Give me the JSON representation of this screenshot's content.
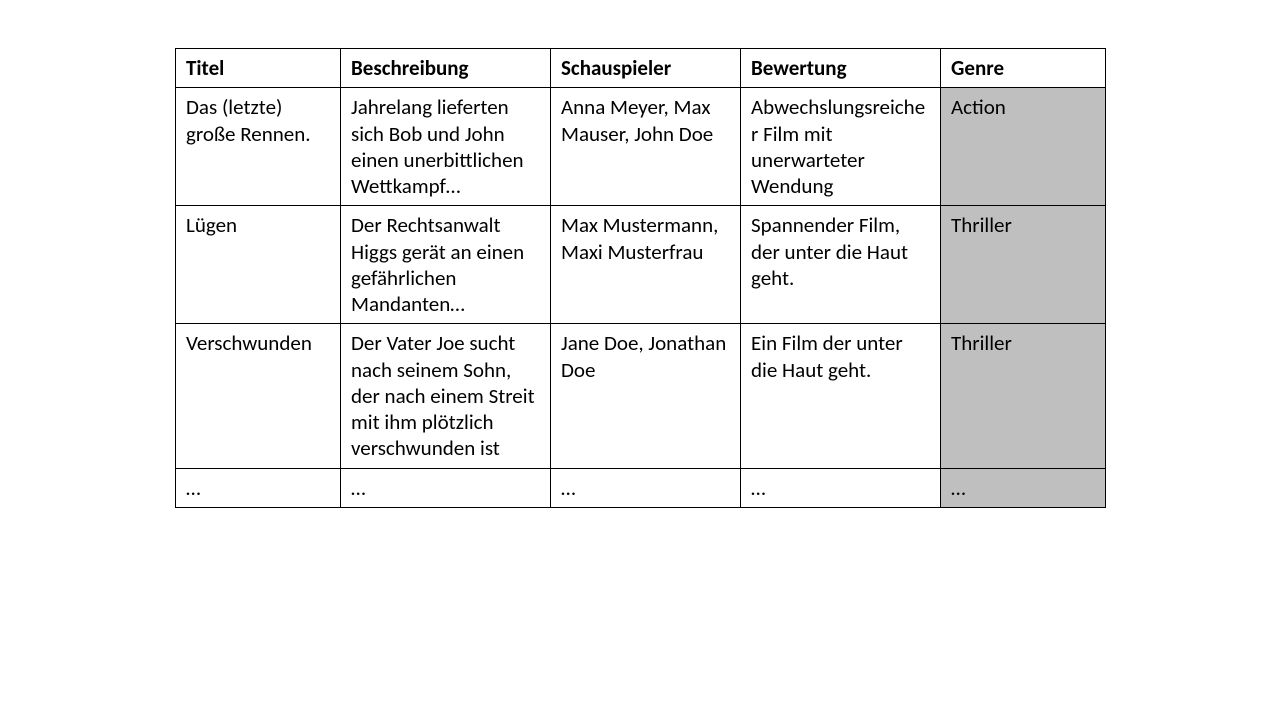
{
  "chart_data": {
    "type": "table",
    "columns": [
      "Titel",
      "Beschreibung",
      "Schauspieler",
      "Bewertung",
      "Genre"
    ],
    "rows": [
      [
        "Das (letzte) große Rennen.",
        "Jahrelang lieferten sich Bob und John einen unerbittlichen Wettkampf…",
        "Anna Meyer, Max Mauser, John Doe",
        "Abwechslungsreicher Film mit unerwarteter Wendung",
        "Action"
      ],
      [
        "Lügen",
        "Der Rechtsanwalt Higgs gerät an einen gefährlichen Mandanten…",
        "Max Mustermann, Maxi Musterfrau",
        "Spannender Film, der unter die Haut geht.",
        "Thriller"
      ],
      [
        "Verschwunden",
        "Der Vater Joe sucht nach seinem Sohn, der nach einem Streit mit ihm plötzlich verschwunden ist",
        "Jane Doe, Jonathan Doe",
        "Ein Film der unter die Haut geht.",
        "Thriller"
      ],
      [
        "…",
        "…",
        "…",
        "…",
        "…"
      ]
    ]
  },
  "table": {
    "headers": {
      "title": "Titel",
      "description": "Beschreibung",
      "actors": "Schauspieler",
      "rating": "Bewertung",
      "genre": "Genre"
    },
    "rows": [
      {
        "title": "Das (letzte) große Rennen.",
        "description": "Jahrelang lieferten sich Bob und John einen unerbittlichen Wettkampf…",
        "actors": "Anna Meyer, Max Mauser, John Doe",
        "rating": "Abwechslungsreicher Film mit unerwarteter Wendung",
        "genre": "Action"
      },
      {
        "title": "Lügen",
        "description": "Der Rechtsanwalt Higgs gerät an einen gefährlichen Mandanten…",
        "actors": "Max Mustermann, Maxi Musterfrau",
        "rating": "Spannender Film, der unter die Haut geht.",
        "genre": "Thriller"
      },
      {
        "title": "Verschwunden",
        "description": "Der Vater Joe sucht nach seinem Sohn, der nach einem Streit mit ihm plötzlich verschwunden ist",
        "actors": "Jane Doe, Jonathan Doe",
        "rating": "Ein Film der unter die Haut geht.",
        "genre": "Thriller"
      },
      {
        "title": "…",
        "description": "…",
        "actors": "…",
        "rating": "…",
        "genre": "…"
      }
    ]
  }
}
